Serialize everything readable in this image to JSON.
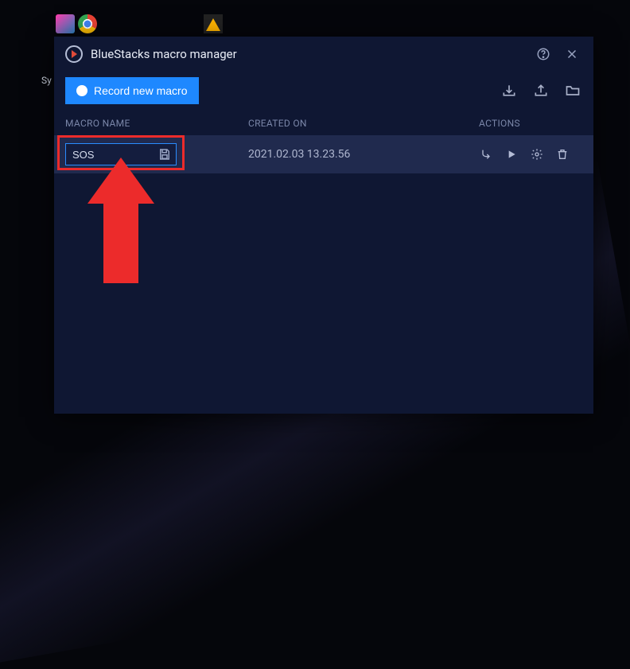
{
  "desktop": {
    "sy_label": "Sy"
  },
  "window": {
    "title": "BlueStacks macro manager",
    "toolbar": {
      "record_label": "Record new macro"
    },
    "columns": {
      "name": "MACRO NAME",
      "created": "CREATED ON",
      "actions": "ACTIONS"
    },
    "rows": [
      {
        "name": "SOS",
        "created": "2021.02.03 13.23.56"
      }
    ]
  }
}
